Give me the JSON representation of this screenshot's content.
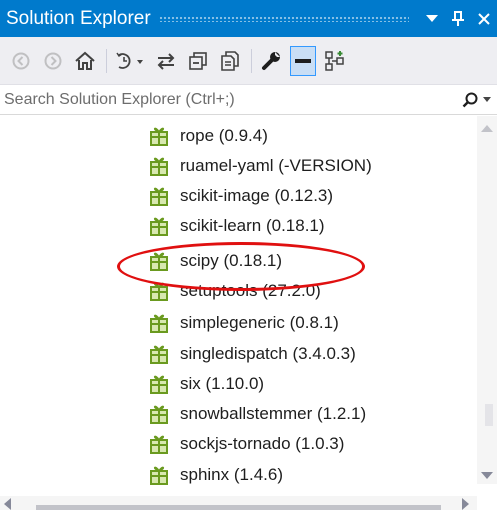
{
  "window": {
    "title": "Solution Explorer",
    "dropdown_icon": "caret-down-icon",
    "pin_icon": "pin-icon"
  },
  "toolbar": {
    "buttons": [
      {
        "name": "back-button",
        "icon": "circle-arrow-left-icon",
        "enabled": false
      },
      {
        "name": "forward-button",
        "icon": "circle-arrow-right-icon",
        "enabled": false
      },
      {
        "name": "home-button",
        "icon": "home-icon",
        "enabled": true
      },
      {
        "name": "pending-changes-filter-button",
        "icon": "clock-history-icon",
        "enabled": true
      },
      {
        "name": "sync-with-active-document-button",
        "icon": "sync-arrows-icon",
        "enabled": true
      },
      {
        "name": "collapse-all-button",
        "icon": "collapse-all-icon",
        "enabled": true
      },
      {
        "name": "show-all-files-button",
        "icon": "show-all-files-icon",
        "enabled": true
      },
      {
        "name": "properties-button",
        "icon": "wrench-icon",
        "enabled": true
      },
      {
        "name": "preview-selected-items-button",
        "icon": "preview-icon",
        "enabled": true,
        "pressed": true
      },
      {
        "name": "class-view-button",
        "icon": "class-diagram-icon",
        "enabled": true
      }
    ]
  },
  "search": {
    "placeholder": "Search Solution Explorer (Ctrl+;)",
    "value": ""
  },
  "tree": {
    "items": [
      {
        "label": "rope (0.9.4)"
      },
      {
        "label": "ruamel-yaml (-VERSION)"
      },
      {
        "label": "scikit-image (0.12.3)"
      },
      {
        "label": "scikit-learn (0.18.1)"
      },
      {
        "label": "scipy (0.18.1)",
        "highlighted": true
      },
      {
        "label": "setuptools (27.2.0)"
      },
      {
        "label": "simplegeneric (0.8.1)"
      },
      {
        "label": "singledispatch (3.4.0.3)"
      },
      {
        "label": "six (1.10.0)"
      },
      {
        "label": "snowballstemmer (1.2.1)"
      },
      {
        "label": "sockjs-tornado (1.0.3)"
      },
      {
        "label": "sphinx (1.4.6)"
      }
    ],
    "item_icon": "package-icon"
  },
  "colors": {
    "titlebar": "#007acc",
    "toolbar": "#eeeef2",
    "annotation": "#e01010",
    "package_icon": "#6a9a1f"
  }
}
